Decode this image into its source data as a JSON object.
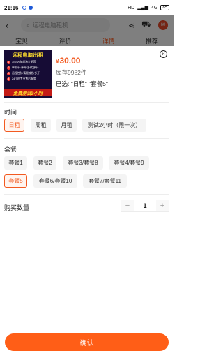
{
  "status_bar": {
    "time": "21:16",
    "network": "HD",
    "signal": "4G",
    "battery": "85"
  },
  "header": {
    "search_placeholder": "远程电脑租机",
    "cart_badge": "60"
  },
  "tabs": [
    "宝贝",
    "评价",
    "详情",
    "推荐"
  ],
  "product": {
    "image_title": "远程电脑出租",
    "image_lines": [
      "3/4/5/9年前跑步配置",
      "单机/开/多开/多代/多开",
      "远程控制/请假流程/多开",
      "24小时专业售后服务"
    ],
    "image_banner": "免费测试2小时",
    "currency": "¥",
    "price": "30.00",
    "stock": "库存9982件",
    "selected": "已选: \"日租\" \"套餐5\""
  },
  "time_section": {
    "title": "时间",
    "options": [
      "日租",
      "周租",
      "月租",
      "测试2小时（限一次）"
    ],
    "selected": "日租"
  },
  "package_section": {
    "title": "套餐",
    "options": [
      "套餐1",
      "套餐2",
      "套餐3/套餐8",
      "套餐4/套餐9",
      "套餐5",
      "套餐6/套餐10",
      "套餐7/套餐11"
    ],
    "selected": "套餐5"
  },
  "quantity": {
    "label": "购买数量",
    "value": "1",
    "minus": "−",
    "plus": "+"
  },
  "confirm_label": "确认",
  "colors": {
    "accent": "#f25a21",
    "button": "#ff5e17"
  }
}
